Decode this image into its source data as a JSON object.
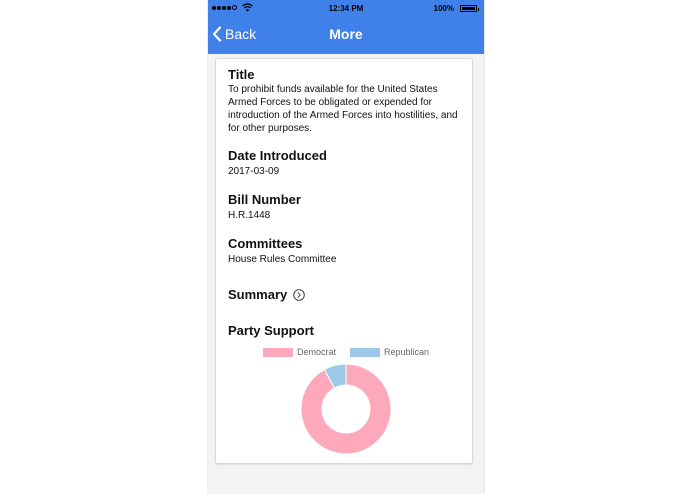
{
  "status_bar": {
    "time": "12:34 PM",
    "battery_pct": "100%",
    "battery_level": 1.0,
    "signal_bars": 4
  },
  "nav": {
    "back_label": "Back",
    "title": "More",
    "color": "#3f80e9"
  },
  "bill": {
    "title_heading": "Title",
    "title_text": "To prohibit funds available for the United States Armed Forces to be obligated or expended for introduction of the Armed Forces into hostilities, and for other purposes.",
    "date_heading": "Date Introduced",
    "date_value": "2017-03-09",
    "number_heading": "Bill Number",
    "number_value": "H.R.1448",
    "committees_heading": "Committees",
    "committees_value": "House Rules Committee",
    "summary_label": "Summary",
    "party_heading": "Party Support"
  },
  "chart_data": {
    "type": "pie",
    "donut": true,
    "legend_position": "top",
    "series": [
      {
        "name": "Democrat",
        "value": 92,
        "color": "#fea8bb"
      },
      {
        "name": "Republican",
        "value": 8,
        "color": "#9dc9e8"
      }
    ]
  },
  "icons": {
    "back": "chevron-left-icon",
    "summary": "chevron-right-circle-icon",
    "wifi": "wifi-icon",
    "battery": "battery-icon"
  }
}
